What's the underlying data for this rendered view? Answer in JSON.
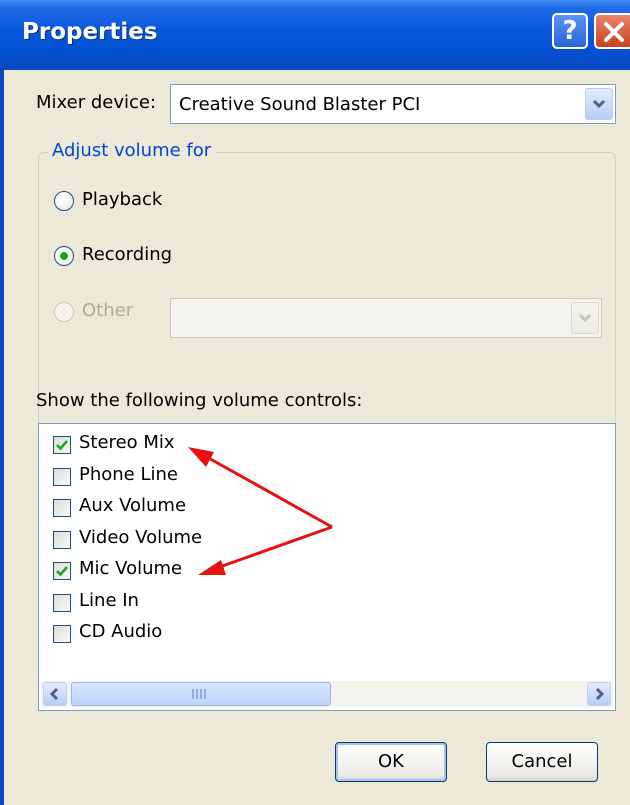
{
  "window": {
    "title": "Properties",
    "help_glyph": "?"
  },
  "mixer": {
    "label": "Mixer device:",
    "selected": "Creative Sound Blaster PCI"
  },
  "adjust_group": {
    "legend": "Adjust volume for",
    "options": [
      {
        "label": "Playback",
        "checked": false,
        "enabled": true
      },
      {
        "label": "Recording",
        "checked": true,
        "enabled": true
      },
      {
        "label": "Other",
        "checked": false,
        "enabled": false
      }
    ]
  },
  "controls": {
    "label": "Show the following volume controls:",
    "items": [
      {
        "label": "Stereo Mix",
        "checked": true
      },
      {
        "label": "Phone Line",
        "checked": false
      },
      {
        "label": "Aux Volume",
        "checked": false
      },
      {
        "label": "Video Volume",
        "checked": false
      },
      {
        "label": "Mic Volume",
        "checked": true
      },
      {
        "label": "Line In",
        "checked": false
      },
      {
        "label": "CD Audio",
        "checked": false
      }
    ]
  },
  "buttons": {
    "ok": "OK",
    "cancel": "Cancel"
  },
  "colors": {
    "titlebar": "#0450d0",
    "annotation_arrow": "#e81010",
    "check": "#21a121"
  }
}
